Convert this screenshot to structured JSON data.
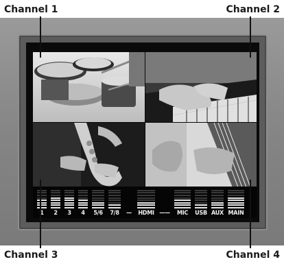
{
  "callouts": {
    "channel1": "Channel 1",
    "channel2": "Channel 2",
    "channel3": "Channel 3",
    "channel4": "Channel 4"
  },
  "meters": {
    "labels": [
      "1",
      "2",
      "3",
      "4",
      "5/6",
      "7/8",
      "—",
      "HDMI",
      "——",
      "MIC",
      "USB",
      "AUX",
      "MAIN"
    ],
    "levels": [
      0.55,
      0.62,
      0.62,
      0.55,
      0.35,
      0.28,
      0.0,
      0.35,
      0.0,
      0.45,
      0.3,
      0.4,
      0.65
    ]
  },
  "quadrants": {
    "q1": "drums",
    "q2": "piano",
    "q3": "saxophone",
    "q4": "guitar"
  }
}
